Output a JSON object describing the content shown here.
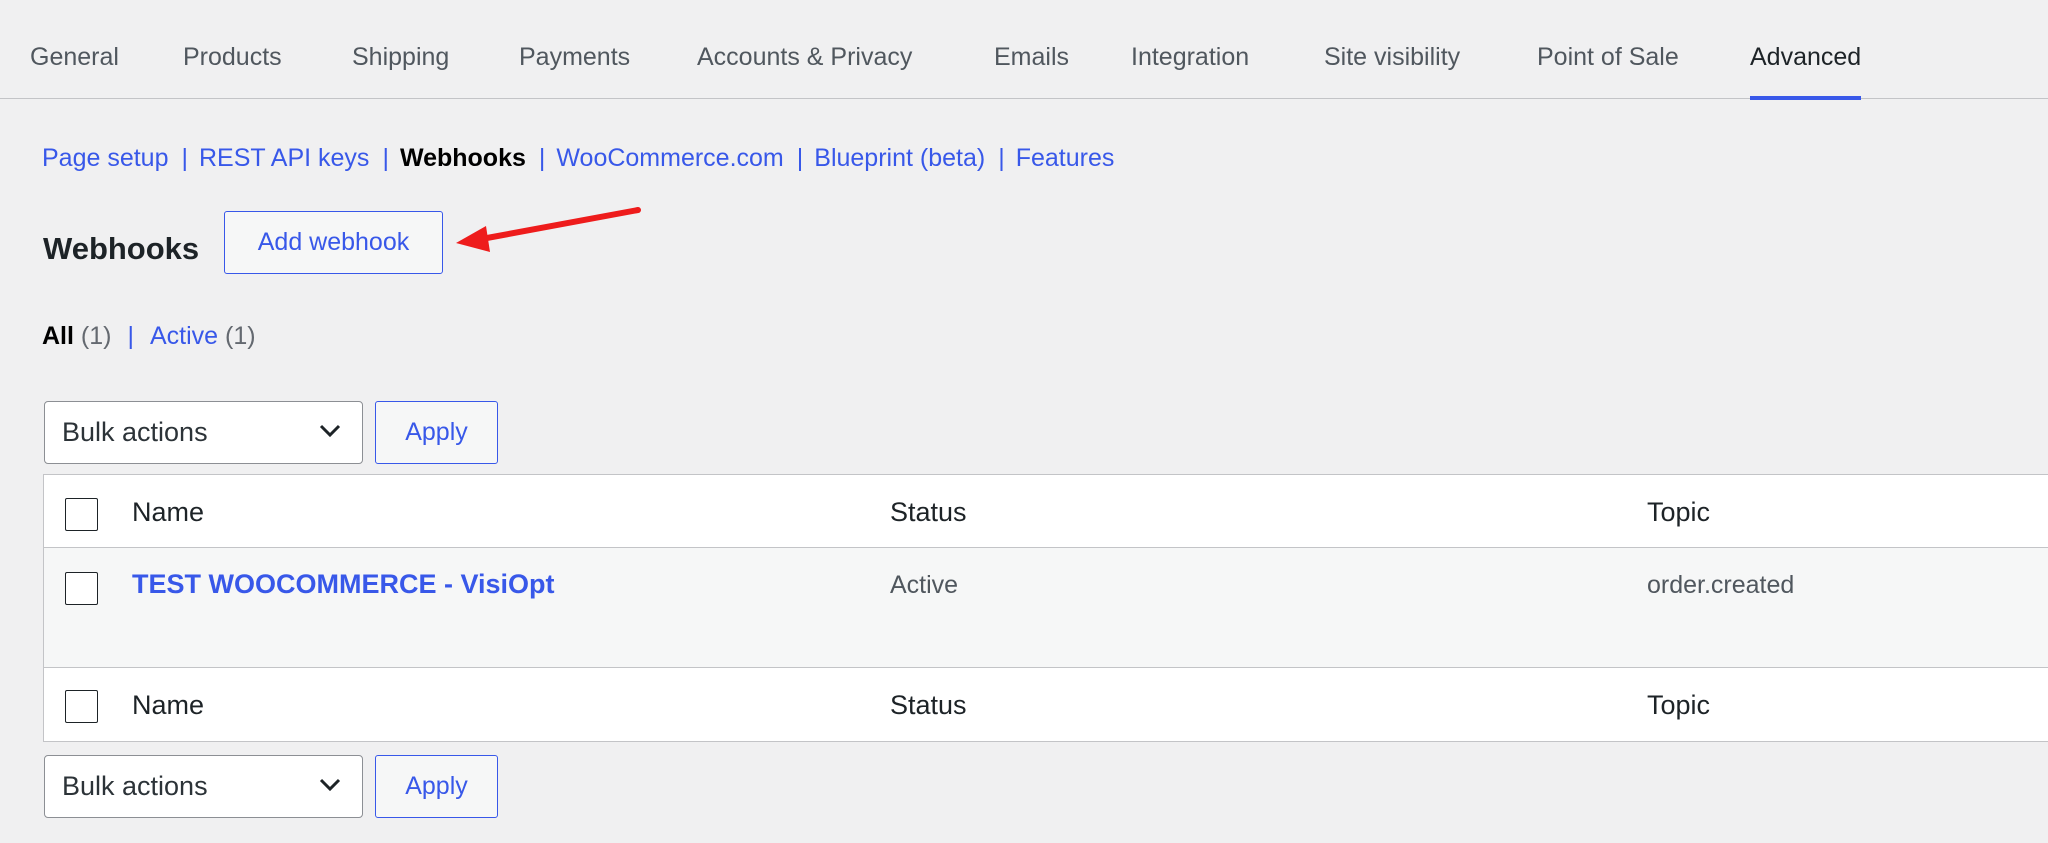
{
  "tabs": [
    {
      "label": "General"
    },
    {
      "label": "Products"
    },
    {
      "label": "Shipping"
    },
    {
      "label": "Payments"
    },
    {
      "label": "Accounts & Privacy"
    },
    {
      "label": "Emails"
    },
    {
      "label": "Integration"
    },
    {
      "label": "Site visibility"
    },
    {
      "label": "Point of Sale"
    },
    {
      "label": "Advanced"
    }
  ],
  "active_tab": "Advanced",
  "subnav": {
    "page_setup": "Page setup",
    "rest_api_keys": "REST API keys",
    "webhooks": "Webhooks",
    "woocommerce_com": "WooCommerce.com",
    "blueprint": "Blueprint (beta)",
    "features": "Features",
    "separator": "|"
  },
  "page": {
    "title": "Webhooks",
    "add_button": "Add webhook"
  },
  "filters": {
    "all_label": "All",
    "all_count": "(1)",
    "active_label": "Active",
    "active_count": "(1)",
    "separator": "|"
  },
  "bulk": {
    "selected": "Bulk actions",
    "apply_label": "Apply"
  },
  "table": {
    "columns": {
      "name": "Name",
      "status": "Status",
      "topic": "Topic"
    },
    "rows": [
      {
        "name": "TEST WOOCOMMERCE - VisiOpt",
        "status": "Active",
        "topic": "order.created"
      }
    ]
  },
  "colors": {
    "accent": "#3858e9",
    "annotation_arrow": "#ee1c1c",
    "background": "#f0f0f1"
  },
  "icons": {
    "dropdown": "chevron-down-icon",
    "annotation": "red-arrow-icon"
  }
}
